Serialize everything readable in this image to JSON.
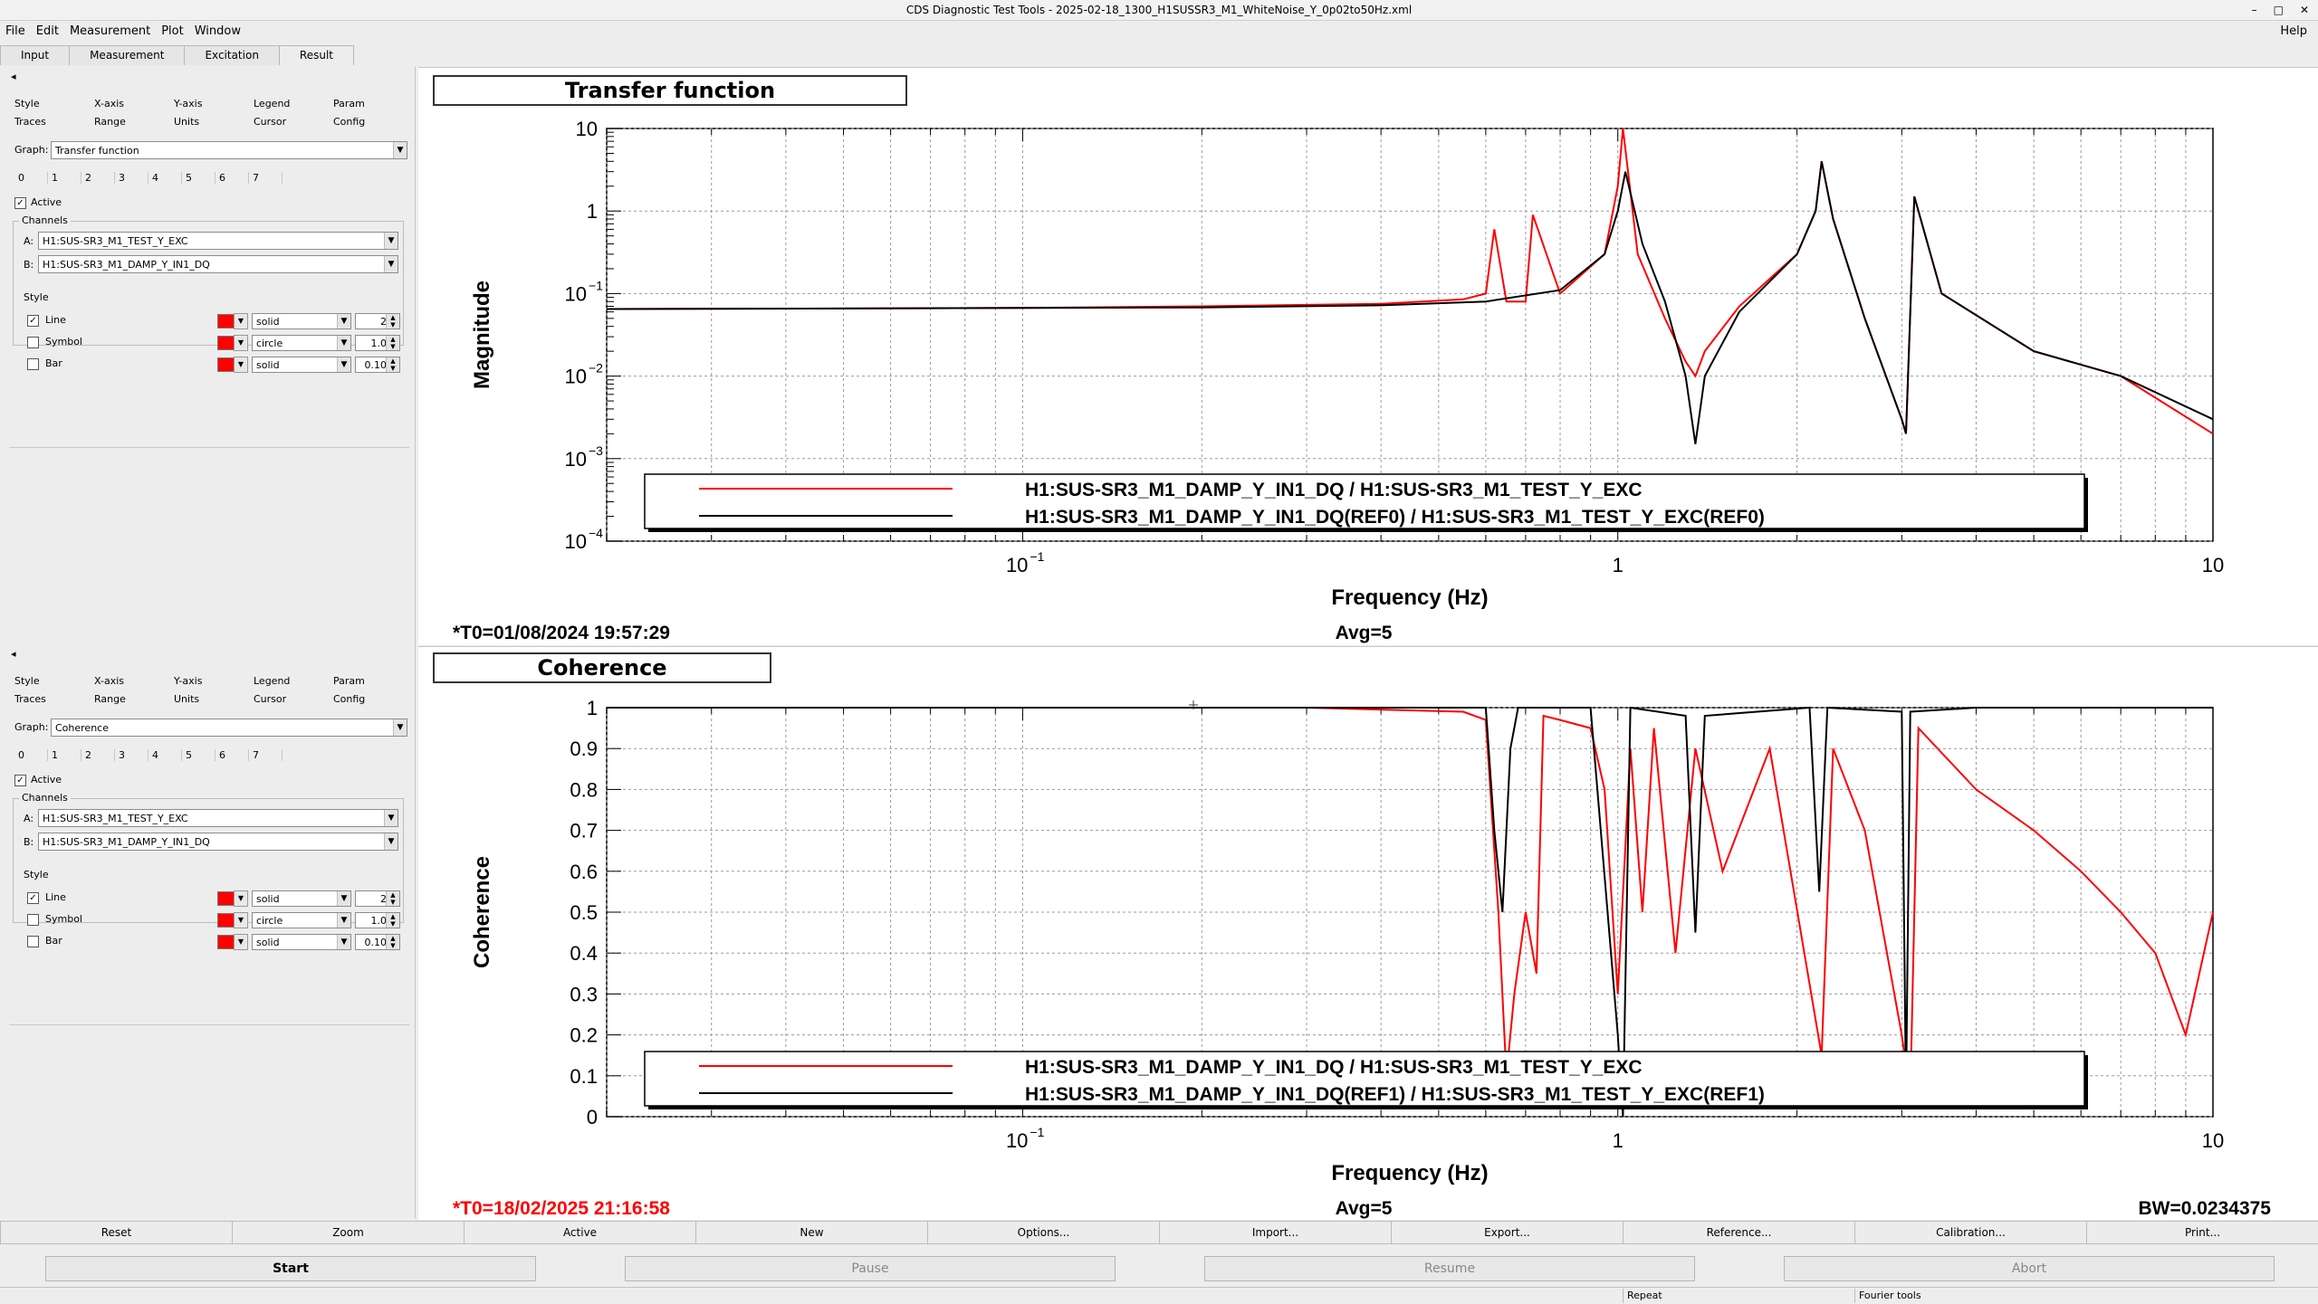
{
  "window": {
    "title": "CDS Diagnostic Test Tools - 2025-02-18_1300_H1SUSSR3_M1_WhiteNoise_Y_0p02to50Hz.xml"
  },
  "menu": {
    "items": [
      "File",
      "Edit",
      "Measurement",
      "Plot",
      "Window"
    ],
    "help": "Help"
  },
  "main_tabs": [
    "Input",
    "Measurement",
    "Excitation",
    "Result"
  ],
  "panels": [
    {
      "ctabs_row1": [
        "Style",
        "X-axis",
        "Y-axis",
        "Legend",
        "Param"
      ],
      "ctabs_row2": [
        "Traces",
        "Range",
        "Units",
        "Cursor",
        "Config"
      ],
      "graph_label": "Graph:",
      "graph_value": "Transfer function",
      "trace_tabs": [
        "0",
        "1",
        "2",
        "3",
        "4",
        "5",
        "6",
        "7"
      ],
      "active_label": "Active",
      "channels_label": "Channels",
      "channel_a_label": "A:",
      "channel_a": "H1:SUS-SR3_M1_TEST_Y_EXC",
      "channel_b_label": "B:",
      "channel_b": "H1:SUS-SR3_M1_DAMP_Y_IN1_DQ",
      "style_label": "Style",
      "line_label": "Line",
      "line_style": "solid",
      "line_width": "2",
      "symbol_label": "Symbol",
      "symbol_style": "circle",
      "symbol_size": "1.0",
      "bar_label": "Bar",
      "bar_style": "solid",
      "bar_width": "0.10"
    },
    {
      "ctabs_row1": [
        "Style",
        "X-axis",
        "Y-axis",
        "Legend",
        "Param"
      ],
      "ctabs_row2": [
        "Traces",
        "Range",
        "Units",
        "Cursor",
        "Config"
      ],
      "graph_label": "Graph:",
      "graph_value": "Coherence",
      "trace_tabs": [
        "0",
        "1",
        "2",
        "3",
        "4",
        "5",
        "6",
        "7"
      ],
      "active_label": "Active",
      "channels_label": "Channels",
      "channel_a_label": "A:",
      "channel_a": "H1:SUS-SR3_M1_TEST_Y_EXC",
      "channel_b_label": "B:",
      "channel_b": "H1:SUS-SR3_M1_DAMP_Y_IN1_DQ",
      "style_label": "Style",
      "line_label": "Line",
      "line_style": "solid",
      "line_width": "2",
      "symbol_label": "Symbol",
      "symbol_style": "circle",
      "symbol_size": "1.0",
      "bar_label": "Bar",
      "bar_style": "solid",
      "bar_width": "0.10"
    }
  ],
  "plots": {
    "tf": {
      "title": "Transfer function",
      "ylabel": "Magnitude",
      "xlabel": "Frequency (Hz)",
      "xticks": [
        "10",
        "1",
        "10"
      ],
      "xtick_exp": "−1",
      "yticks": [
        "10",
        "1",
        "10",
        "10",
        "10",
        "10"
      ],
      "ytick_exps": [
        "",
        "",
        "−1",
        "−2",
        "−3",
        "−4"
      ],
      "legend": [
        "H1:SUS-SR3_M1_DAMP_Y_IN1_DQ / H1:SUS-SR3_M1_TEST_Y_EXC",
        "H1:SUS-SR3_M1_DAMP_Y_IN1_DQ(REF0) / H1:SUS-SR3_M1_TEST_Y_EXC(REF0)"
      ],
      "t0": "*T0=01/08/2024 19:57:29",
      "avg": "Avg=5"
    },
    "coh": {
      "title": "Coherence",
      "ylabel": "Coherence",
      "xlabel": "Frequency (Hz)",
      "xticks": [
        "10",
        "1",
        "10"
      ],
      "xtick_exp": "−1",
      "yticks": [
        "1",
        "0.9",
        "0.8",
        "0.7",
        "0.6",
        "0.5",
        "0.4",
        "0.3",
        "0.2",
        "0.1",
        "0"
      ],
      "legend": [
        "H1:SUS-SR3_M1_DAMP_Y_IN1_DQ / H1:SUS-SR3_M1_TEST_Y_EXC",
        "H1:SUS-SR3_M1_DAMP_Y_IN1_DQ(REF1) / H1:SUS-SR3_M1_TEST_Y_EXC(REF1)"
      ],
      "t0": "*T0=18/02/2025 21:16:58",
      "avg": "Avg=5",
      "bw": "BW=0.0234375"
    }
  },
  "colors": {
    "current": "#ff0000",
    "reference": "#000000",
    "t0_highlight": "#ff0000"
  },
  "bottom_buttons": [
    "Reset",
    "Zoom",
    "Active",
    "New",
    "Options...",
    "Import...",
    "Export...",
    "Reference...",
    "Calibration...",
    "Print..."
  ],
  "run_buttons": [
    "Start",
    "Pause",
    "Resume",
    "Abort"
  ],
  "status": {
    "repeat": "Repeat",
    "fourier": "Fourier tools"
  },
  "chart_data": [
    {
      "type": "line",
      "title": "Transfer function",
      "xlabel": "Frequency (Hz)",
      "ylabel": "Magnitude",
      "xscale": "log",
      "yscale": "log",
      "xlim": [
        0.02,
        10
      ],
      "ylim": [
        0.0001,
        10
      ],
      "grid": true,
      "legend": "bottom-center",
      "series": [
        {
          "name": "H1:SUS-SR3_M1_DAMP_Y_IN1_DQ / H1:SUS-SR3_M1_TEST_Y_EXC",
          "color": "#ff0000",
          "x": [
            0.02,
            0.05,
            0.1,
            0.2,
            0.4,
            0.55,
            0.6,
            0.62,
            0.65,
            0.7,
            0.72,
            0.8,
            0.95,
            1.0,
            1.02,
            1.08,
            1.2,
            1.3,
            1.35,
            1.4,
            1.6,
            2.0,
            2.15,
            2.2,
            2.3,
            2.6,
            3.0,
            3.05,
            3.15,
            3.5,
            5.0,
            7.0,
            10.0
          ],
          "y": [
            0.065,
            0.066,
            0.067,
            0.07,
            0.075,
            0.085,
            0.1,
            0.6,
            0.08,
            0.08,
            0.9,
            0.1,
            0.3,
            2.0,
            10,
            0.3,
            0.05,
            0.015,
            0.01,
            0.02,
            0.07,
            0.3,
            1.0,
            4.0,
            0.8,
            0.05,
            0.003,
            0.002,
            1.5,
            0.1,
            0.02,
            0.01,
            0.002
          ]
        },
        {
          "name": "H1:SUS-SR3_M1_DAMP_Y_IN1_DQ(REF0) / H1:SUS-SR3_M1_TEST_Y_EXC(REF0)",
          "color": "#000000",
          "x": [
            0.02,
            0.05,
            0.1,
            0.2,
            0.4,
            0.6,
            0.8,
            0.95,
            1.0,
            1.03,
            1.1,
            1.2,
            1.3,
            1.35,
            1.4,
            1.6,
            2.0,
            2.15,
            2.2,
            2.3,
            2.6,
            3.0,
            3.05,
            3.15,
            3.5,
            5.0,
            7.0,
            10.0
          ],
          "y": [
            0.065,
            0.066,
            0.067,
            0.068,
            0.072,
            0.08,
            0.11,
            0.3,
            1.0,
            3.0,
            0.4,
            0.08,
            0.01,
            0.0015,
            0.01,
            0.06,
            0.3,
            1.0,
            4.0,
            0.8,
            0.05,
            0.003,
            0.002,
            1.5,
            0.1,
            0.02,
            0.01,
            0.003
          ]
        }
      ]
    },
    {
      "type": "line",
      "title": "Coherence",
      "xlabel": "Frequency (Hz)",
      "ylabel": "Coherence",
      "xscale": "log",
      "xlim": [
        0.02,
        10
      ],
      "ylim": [
        0,
        1
      ],
      "grid": true,
      "legend": "bottom-center",
      "series": [
        {
          "name": "H1:SUS-SR3_M1_DAMP_Y_IN1_DQ / H1:SUS-SR3_M1_TEST_Y_EXC",
          "color": "#ff0000",
          "x": [
            0.02,
            0.3,
            0.55,
            0.6,
            0.63,
            0.65,
            0.67,
            0.7,
            0.73,
            0.75,
            0.8,
            0.9,
            0.95,
            1.0,
            1.05,
            1.1,
            1.15,
            1.25,
            1.35,
            1.5,
            1.8,
            2.2,
            2.3,
            2.6,
            3.0,
            3.1,
            3.2,
            4.0,
            5.0,
            6.0,
            7.0,
            8.0,
            9.0,
            10.0
          ],
          "y": [
            1.0,
            1.0,
            0.99,
            0.97,
            0.5,
            0.1,
            0.3,
            0.5,
            0.35,
            0.98,
            0.97,
            0.95,
            0.8,
            0.3,
            0.9,
            0.5,
            0.95,
            0.4,
            0.9,
            0.6,
            0.9,
            0.15,
            0.9,
            0.7,
            0.2,
            0.05,
            0.95,
            0.8,
            0.7,
            0.6,
            0.5,
            0.4,
            0.2,
            0.5
          ]
        },
        {
          "name": "H1:SUS-SR3_M1_DAMP_Y_IN1_DQ(REF1) / H1:SUS-SR3_M1_TEST_Y_EXC(REF1)",
          "color": "#000000",
          "x": [
            0.02,
            0.3,
            0.6,
            0.62,
            0.64,
            0.66,
            0.68,
            0.9,
            1.0,
            1.02,
            1.05,
            1.3,
            1.35,
            1.4,
            2.1,
            2.18,
            2.25,
            3.0,
            3.05,
            3.1,
            4.0,
            6.0,
            10.0
          ],
          "y": [
            1.0,
            1.0,
            1.0,
            0.7,
            0.5,
            0.9,
            1.0,
            1.0,
            0.2,
            0.0,
            1.0,
            0.98,
            0.45,
            0.98,
            1.0,
            0.55,
            1.0,
            0.99,
            0.05,
            0.99,
            1.0,
            1.0,
            1.0
          ]
        }
      ]
    }
  ]
}
